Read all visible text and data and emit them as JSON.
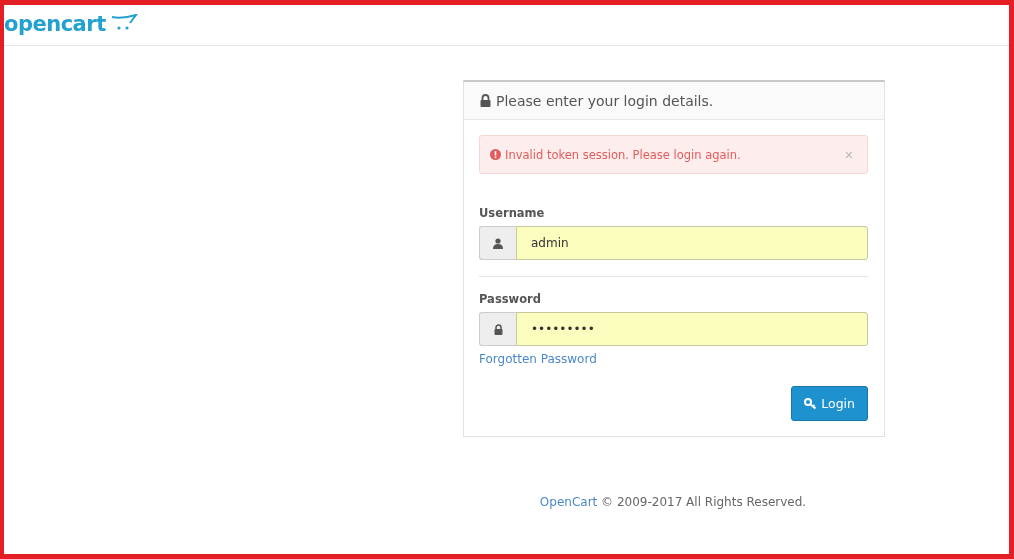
{
  "header": {
    "logo": "opencart"
  },
  "panel": {
    "title": "Please enter your login details.",
    "alert": {
      "message": "Invalid token session. Please login again.",
      "close": "×"
    },
    "fields": [
      {
        "label": "Username",
        "kind": "user",
        "value": "admin"
      },
      {
        "label": "Password",
        "kind": "lock",
        "value": "•••••••••"
      }
    ],
    "forgot_link": "Forgotten Password",
    "login_button": "Login"
  },
  "footer": {
    "link": "OpenCart",
    "text": "© 2009-2017 All Rights Reserved."
  }
}
